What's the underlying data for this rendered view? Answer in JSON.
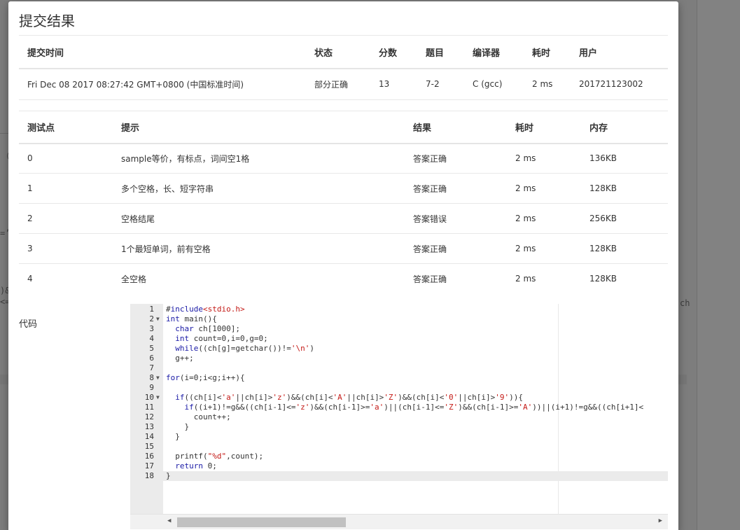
{
  "background": {
    "fragments": [
      "（",
      "=’",
      ")&",
      "<=",
      "ch"
    ]
  },
  "modal": {
    "title": "提交结果",
    "summary": {
      "headers": [
        "提交时间",
        "状态",
        "分数",
        "题目",
        "编译器",
        "耗时",
        "用户"
      ],
      "row": {
        "time": "Fri Dec 08 2017 08:27:42 GMT+0800 (中国标准时间)",
        "status": "部分正确",
        "score": "13",
        "problem": "7-2",
        "compiler": "C (gcc)",
        "elapsed": "2 ms",
        "user": "201721123002"
      }
    },
    "cases": {
      "headers": [
        "测试点",
        "提示",
        "结果",
        "耗时",
        "内存"
      ],
      "rows": [
        {
          "id": "0",
          "hint": "sample等价，有标点，词间空1格",
          "result": "答案正确",
          "time": "2 ms",
          "memory": "136KB"
        },
        {
          "id": "1",
          "hint": "多个空格，长、短字符串",
          "result": "答案正确",
          "time": "2 ms",
          "memory": "128KB"
        },
        {
          "id": "2",
          "hint": "空格结尾",
          "result": "答案错误",
          "time": "2 ms",
          "memory": "256KB"
        },
        {
          "id": "3",
          "hint": "1个最短单词，前有空格",
          "result": "答案正确",
          "time": "2 ms",
          "memory": "128KB"
        },
        {
          "id": "4",
          "hint": "全空格",
          "result": "答案正确",
          "time": "2 ms",
          "memory": "128KB"
        }
      ]
    },
    "code_label": "代码",
    "code_lines": [
      "#include<stdio.h>",
      "int main(){",
      "  char ch[1000];",
      "  int count=0,i=0,g=0;",
      "  while((ch[g]=getchar())!='\\n')",
      "  g++;",
      "",
      "for(i=0;i<g;i++){",
      "",
      "  if((ch[i]<'a'||ch[i]>'z')&&(ch[i]<'A'||ch[i]>'Z')&&(ch[i]<'0'||ch[i]>'9')){",
      "    if((i+1)!=g&&((ch[i-1]<='z')&&(ch[i-1]>='a')||(ch[i-1]<='Z')&&(ch[i-1]>='A'))||(i+1)!=g&&((ch[i+1]<",
      "      count++;",
      "    }",
      "  }",
      "",
      "  printf(\"%d\",count);",
      "  return 0;",
      "}"
    ],
    "fold_lines": [
      2,
      8,
      10
    ]
  },
  "colors": {
    "correct": "#e14c4c",
    "wrong": "#3db04a",
    "partial": "#3db04a",
    "link": "#2f7bd2"
  }
}
